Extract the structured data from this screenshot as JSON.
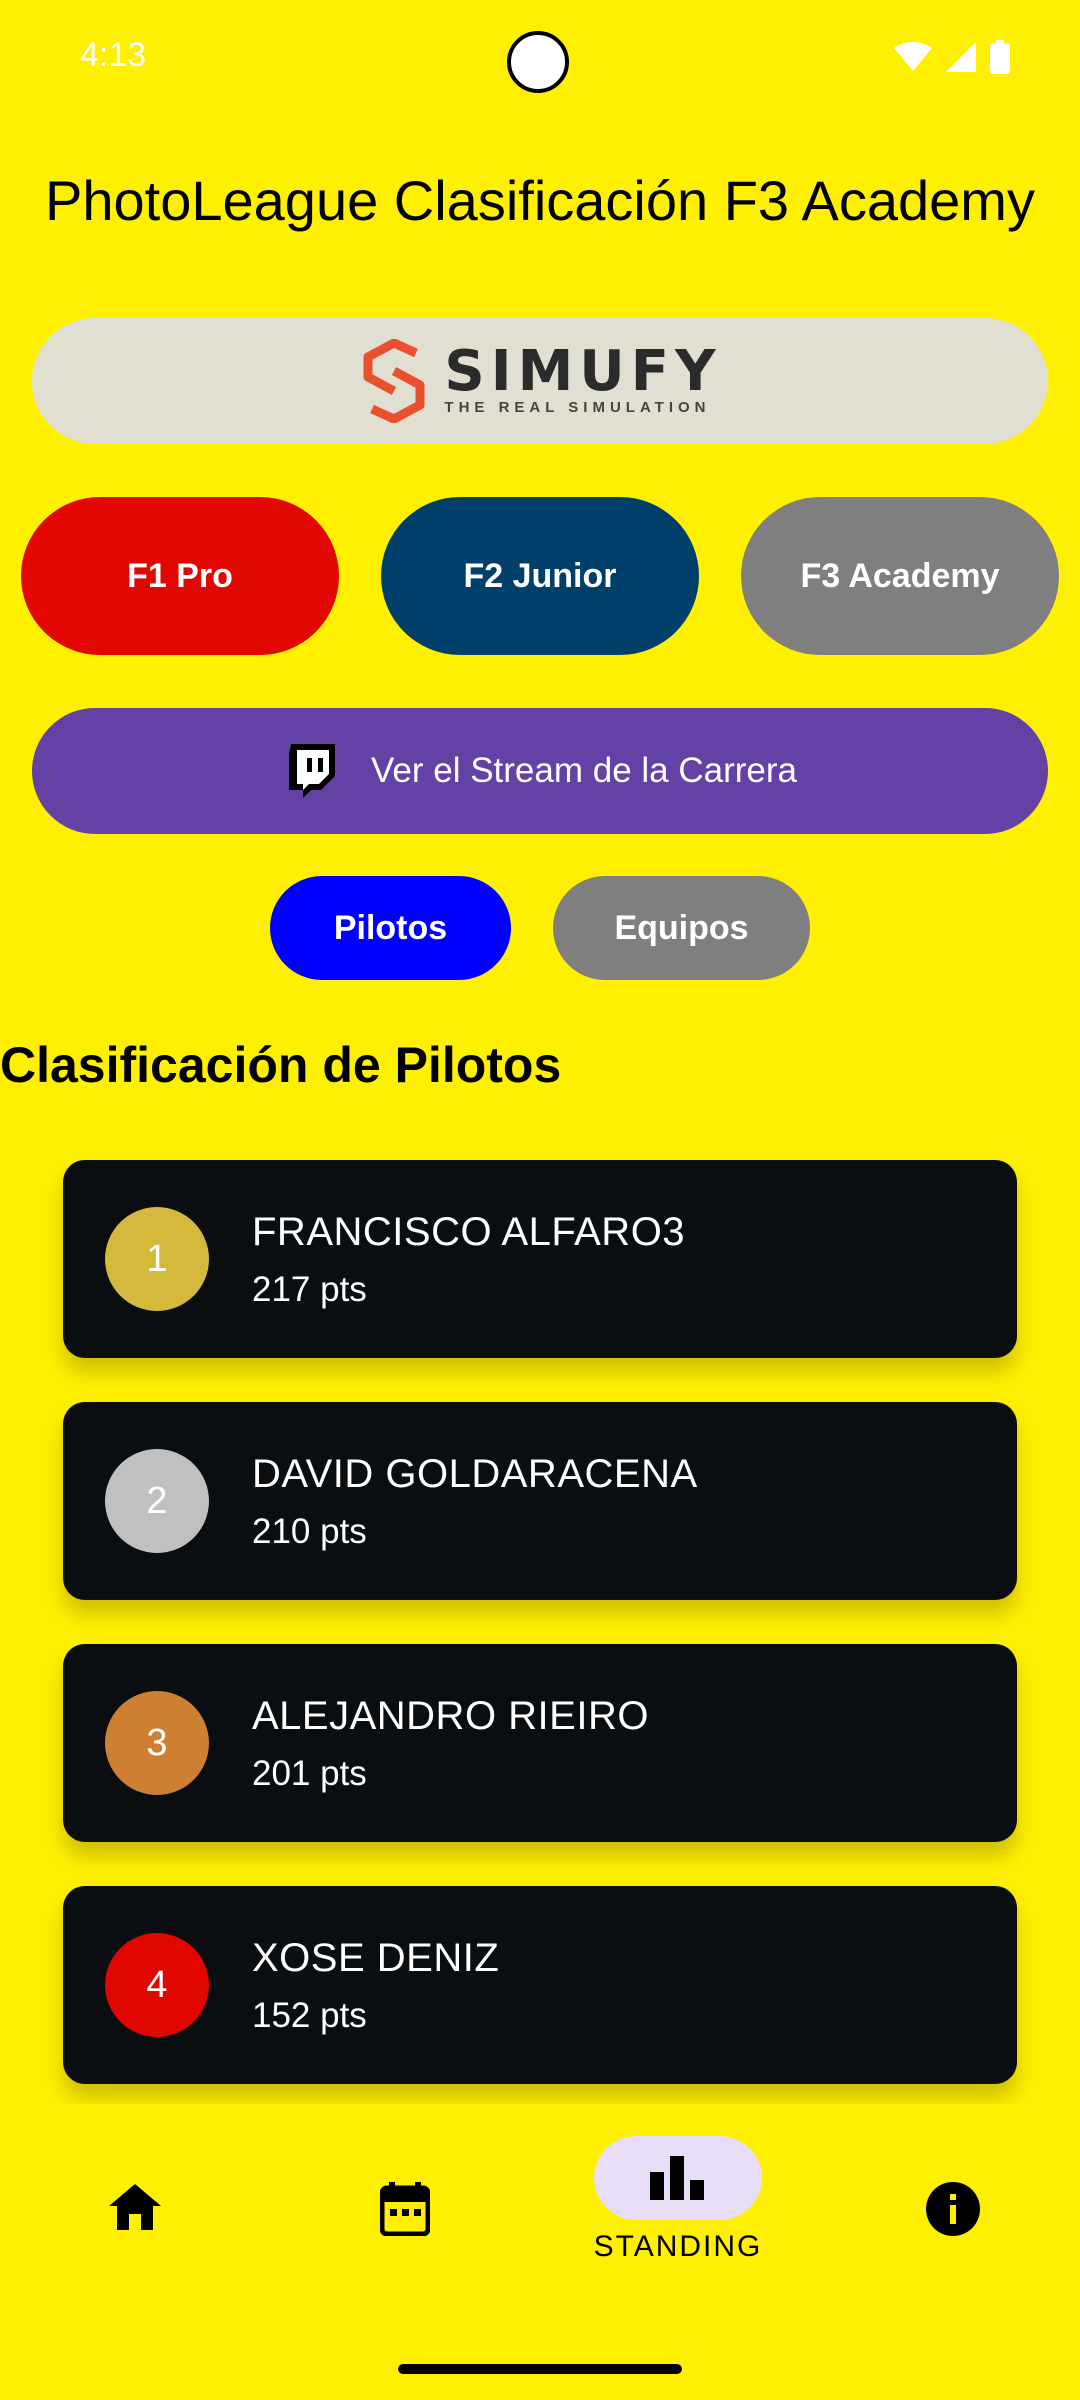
{
  "status_bar": {
    "time": "4:13"
  },
  "header": {
    "title": "PhotoLeague Clasificación F3 Academy"
  },
  "sponsor": {
    "name": "SIMUFY",
    "tagline": "THE REAL SIMULATION"
  },
  "categories": [
    {
      "label": "F1 Pro",
      "color": "#E10600"
    },
    {
      "label": "F2 Junior",
      "color": "#003F6A"
    },
    {
      "label": "F3 Academy",
      "color": "#7F7F7F"
    }
  ],
  "stream_button": {
    "label": "Ver el Stream de la Carrera",
    "icon": "twitch-icon",
    "color": "#6441A5"
  },
  "view_toggle": {
    "pilots": "Pilotos",
    "teams": "Equipos",
    "active": "pilots"
  },
  "section": {
    "heading": "Clasificación de Pilotos"
  },
  "standings": [
    {
      "position": "1",
      "name": "FRANCISCO ALFARO3",
      "points": "217 pts",
      "badge_color": "#D4B93C"
    },
    {
      "position": "2",
      "name": "DAVID GOLDARACENA",
      "points": "210 pts",
      "badge_color": "#C0C0C0"
    },
    {
      "position": "3",
      "name": "ALEJANDRO RIEIRO",
      "points": "201 pts",
      "badge_color": "#CD7F32"
    },
    {
      "position": "4",
      "name": "XOSE DENIZ",
      "points": "152 pts",
      "badge_color": "#E10600"
    }
  ],
  "bottom_nav": {
    "items": [
      {
        "icon": "home-icon"
      },
      {
        "icon": "calendar-icon"
      },
      {
        "icon": "bar-chart-icon",
        "label": "STANDING",
        "active": true
      },
      {
        "icon": "info-icon"
      }
    ]
  },
  "colors": {
    "background": "#FFEF00",
    "card": "#0B0E11"
  }
}
